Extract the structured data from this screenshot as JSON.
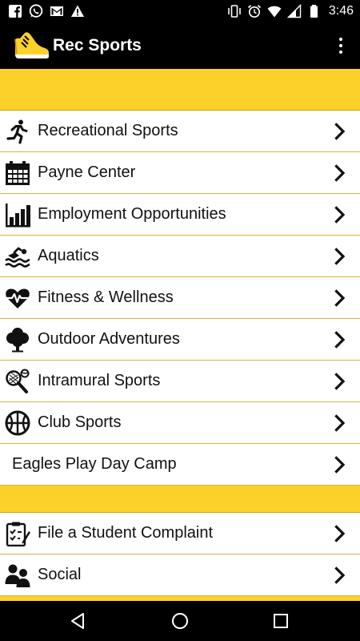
{
  "status_bar": {
    "time": "3:46",
    "left_icons": [
      "facebook-icon",
      "whatsapp-icon",
      "gmail-icon",
      "warning-icon"
    ],
    "right_icons": [
      "vibrate-icon",
      "alarm-icon",
      "wifi-icon",
      "signal-icon",
      "battery-icon"
    ]
  },
  "app_bar": {
    "title": "Rec Sports",
    "logo_icon": "running-shoe-icon",
    "menu_icon": "overflow-menu-icon"
  },
  "menu": {
    "section1": [
      {
        "label": "Recreational Sports",
        "icon": "runner-icon"
      },
      {
        "label": "Payne Center",
        "icon": "calendar-icon"
      },
      {
        "label": "Employment Opportunities",
        "icon": "bar-chart-icon"
      },
      {
        "label": "Aquatics",
        "icon": "swimmer-icon"
      },
      {
        "label": "Fitness & Wellness",
        "icon": "heartbeat-icon"
      },
      {
        "label": "Outdoor Adventures",
        "icon": "tree-icon"
      },
      {
        "label": "Intramural Sports",
        "icon": "racquet-icon"
      },
      {
        "label": "Club Sports",
        "icon": "basketball-icon"
      },
      {
        "label": "Eagles Play Day Camp",
        "icon": ""
      }
    ],
    "section2": [
      {
        "label": "File a Student Complaint",
        "icon": "clipboard-check-icon"
      },
      {
        "label": "Social",
        "icon": "users-icon"
      }
    ]
  },
  "colors": {
    "accent_yellow": "#fcd12a",
    "divider": "#d6b33a",
    "bar_background": "#000000"
  },
  "nav_bar": [
    "back-icon",
    "home-icon",
    "recents-icon"
  ]
}
